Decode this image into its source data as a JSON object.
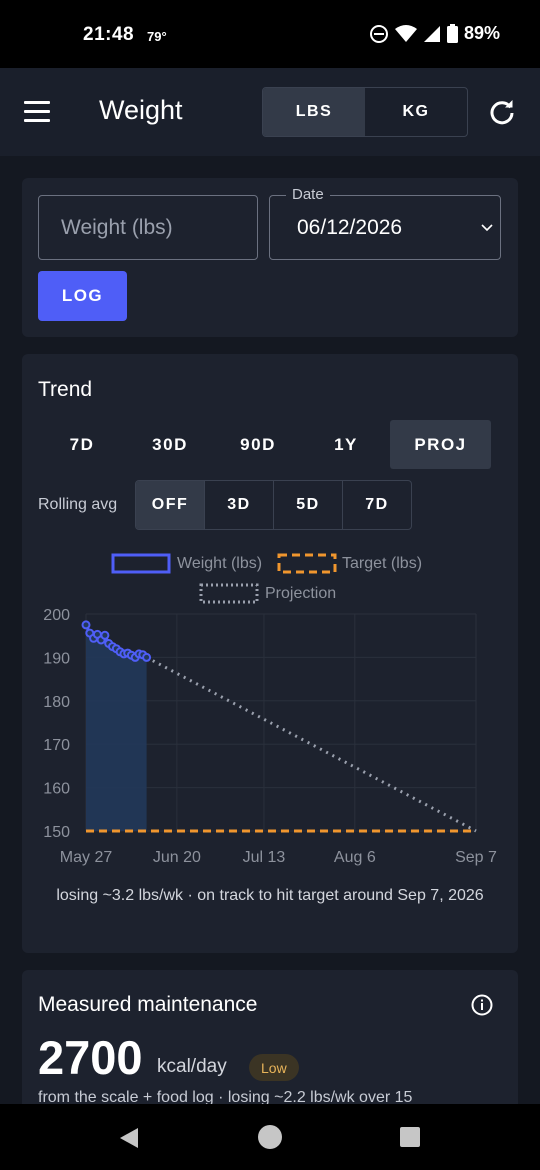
{
  "status": {
    "time": "21:48",
    "temp": "79°",
    "battery": "89%"
  },
  "appbar": {
    "title": "Weight",
    "units": [
      "LBS",
      "KG"
    ],
    "active_unit": "LBS"
  },
  "entry": {
    "weight_placeholder": "Weight (lbs)",
    "date_label": "Date",
    "date_value": "06/12/2026",
    "log_label": "LOG"
  },
  "trend": {
    "title": "Trend",
    "ranges": [
      "7D",
      "30D",
      "90D",
      "1Y",
      "PROJ"
    ],
    "active_range": "PROJ",
    "rolling_label": "Rolling avg",
    "rolling_options": [
      "OFF",
      "3D",
      "5D",
      "7D"
    ],
    "active_rolling": "OFF",
    "summary": "losing ~3.2 lbs/wk · on track to hit target around Sep 7, 2026"
  },
  "chart_data": {
    "type": "line",
    "legend": [
      {
        "name": "Weight (lbs)",
        "color": "#4f5ef7",
        "style": "solid"
      },
      {
        "name": "Target (lbs)",
        "color": "#f0962e",
        "style": "dashed"
      },
      {
        "name": "Projection",
        "color": "#9aa0ad",
        "style": "dotted"
      }
    ],
    "legend_position": "top",
    "y_ticks": [
      "200",
      "190",
      "180",
      "170",
      "160",
      "150"
    ],
    "ylim": [
      150,
      200
    ],
    "x_ticks": [
      "May 27",
      "Jun 20",
      "Jul 13",
      "Aug 6",
      "Sep 7"
    ],
    "x_tick_dates": [
      "2026-05-27",
      "2026-06-20",
      "2026-07-13",
      "2026-08-06",
      "2026-09-07"
    ],
    "xlim": [
      "2026-05-27",
      "2026-09-07"
    ],
    "grid": true,
    "series": [
      {
        "name": "Weight (lbs)",
        "x": [
          "2026-05-27",
          "2026-05-28",
          "2026-05-29",
          "2026-05-30",
          "2026-05-31",
          "2026-06-01",
          "2026-06-02",
          "2026-06-03",
          "2026-06-04",
          "2026-06-05",
          "2026-06-06",
          "2026-06-07",
          "2026-06-08",
          "2026-06-09",
          "2026-06-10",
          "2026-06-11",
          "2026-06-12"
        ],
        "y": [
          197.5,
          195.6,
          194.4,
          195.3,
          194.0,
          195.1,
          193.2,
          192.5,
          192.0,
          191.3,
          190.8,
          191.0,
          190.5,
          190.0,
          190.8,
          190.6,
          190.0
        ],
        "fill_to": 150
      },
      {
        "name": "Target (lbs)",
        "x": [
          "2026-05-27",
          "2026-09-07"
        ],
        "y": [
          150,
          150
        ]
      },
      {
        "name": "Projection",
        "x": [
          "2026-06-12",
          "2026-09-07"
        ],
        "y": [
          190.0,
          150.0
        ]
      }
    ]
  },
  "maintenance": {
    "title": "Measured maintenance",
    "value": "2700",
    "unit": "kcal/day",
    "badge": "Low",
    "subtitle": "from the scale + food log · losing ~2.2 lbs/wk over 15"
  }
}
